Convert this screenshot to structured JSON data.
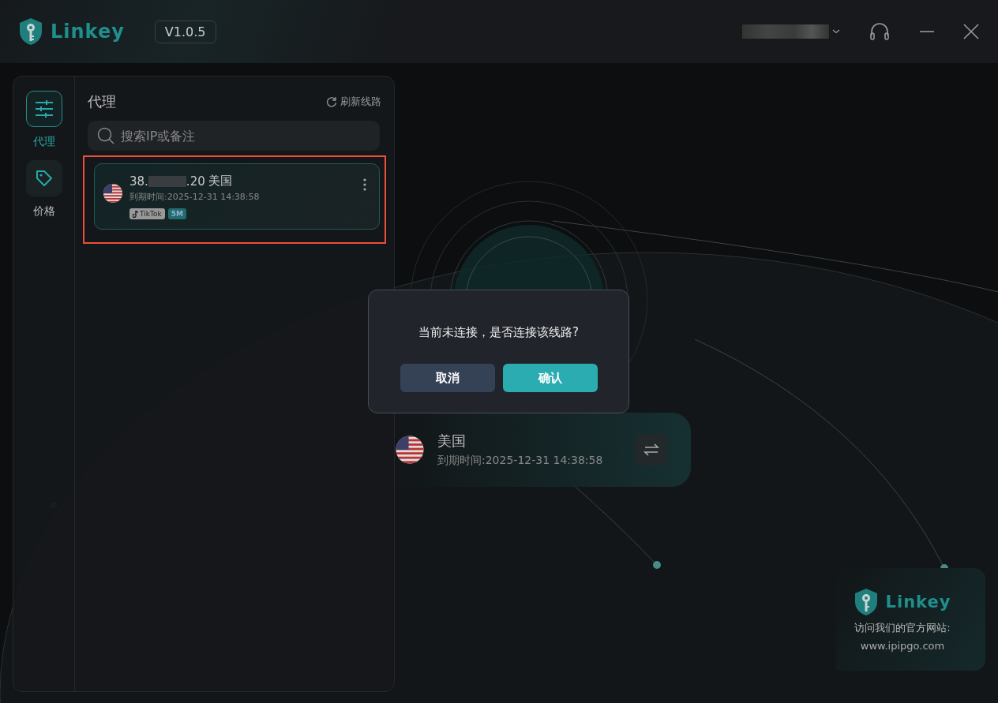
{
  "titlebar": {
    "logo": "Linkey",
    "version": "V1.0.5"
  },
  "sidebar": {
    "items": [
      {
        "label": "代理",
        "kind": "proxy",
        "selected": true
      },
      {
        "label": "价格",
        "kind": "price",
        "selected": false
      }
    ]
  },
  "proxy_panel": {
    "title": "代理",
    "refresh": "刷新线路",
    "search": {
      "placeholder": "搜索IP或备注"
    },
    "items": [
      {
        "ip_prefix": "38.",
        "ip_suffix": ".20",
        "country": "美国",
        "expiry": "到期时间:2025-12-31 14:38:58",
        "tags": [
          {
            "label": "TikTok",
            "kind": "app"
          },
          {
            "label": "5M",
            "kind": "speed"
          }
        ],
        "highlighted": true
      }
    ]
  },
  "connection": {
    "country": "美国",
    "expiry": "到期时间:2025-12-31 14:38:58"
  },
  "website_card": {
    "logo": "Linkey",
    "caption": "访问我们的官方网站:",
    "url": "www.ipipgo.com"
  },
  "dialog": {
    "message": "当前未连接，是否连接该线路?",
    "buttons": [
      {
        "label": "取消",
        "kind": "cancel"
      },
      {
        "label": "确认",
        "kind": "confirm"
      }
    ]
  }
}
